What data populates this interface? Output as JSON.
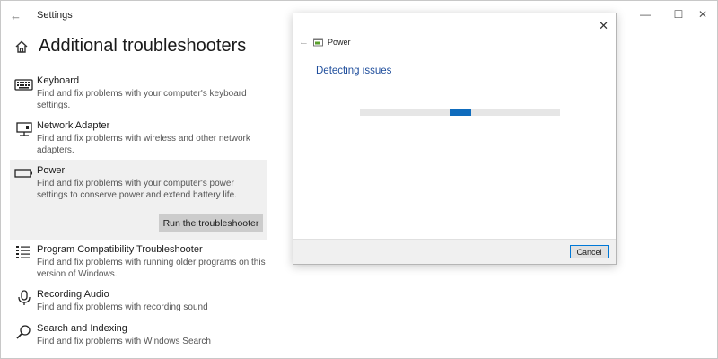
{
  "window": {
    "app_title": "Settings",
    "back_glyph": "←",
    "min_glyph": "—",
    "max_glyph": "☐",
    "close_glyph": "✕"
  },
  "page": {
    "title": "Additional troubleshooters"
  },
  "troubleshooters": [
    {
      "name": "Keyboard",
      "desc": "Find and fix problems with your computer's keyboard settings.",
      "icon": "keyboard-icon"
    },
    {
      "name": "Network Adapter",
      "desc": "Find and fix problems with wireless and other network adapters.",
      "icon": "network-adapter-icon"
    },
    {
      "name": "Power",
      "desc": "Find and fix problems with your computer's power settings to conserve power and extend battery life.",
      "icon": "battery-icon",
      "selected": true,
      "button_label": "Run the troubleshooter"
    },
    {
      "name": "Program Compatibility Troubleshooter",
      "desc": "Find and fix problems with running older programs on this version of Windows.",
      "icon": "list-icon"
    },
    {
      "name": "Recording Audio",
      "desc": "Find and fix problems with recording sound",
      "icon": "microphone-icon"
    },
    {
      "name": "Search and Indexing",
      "desc": "Find and fix problems with Windows Search",
      "icon": "search-icon"
    }
  ],
  "dialog": {
    "title": "Power",
    "close_glyph": "✕",
    "back_glyph": "←",
    "status": "Detecting issues",
    "progress_indeterminate_position": 0.45,
    "cancel_label": "Cancel"
  },
  "colors": {
    "accent": "#0f6cbd",
    "link_blue": "#1f4e9c",
    "selected_bg": "#f0f0f0",
    "button_bg": "#cccccc"
  }
}
